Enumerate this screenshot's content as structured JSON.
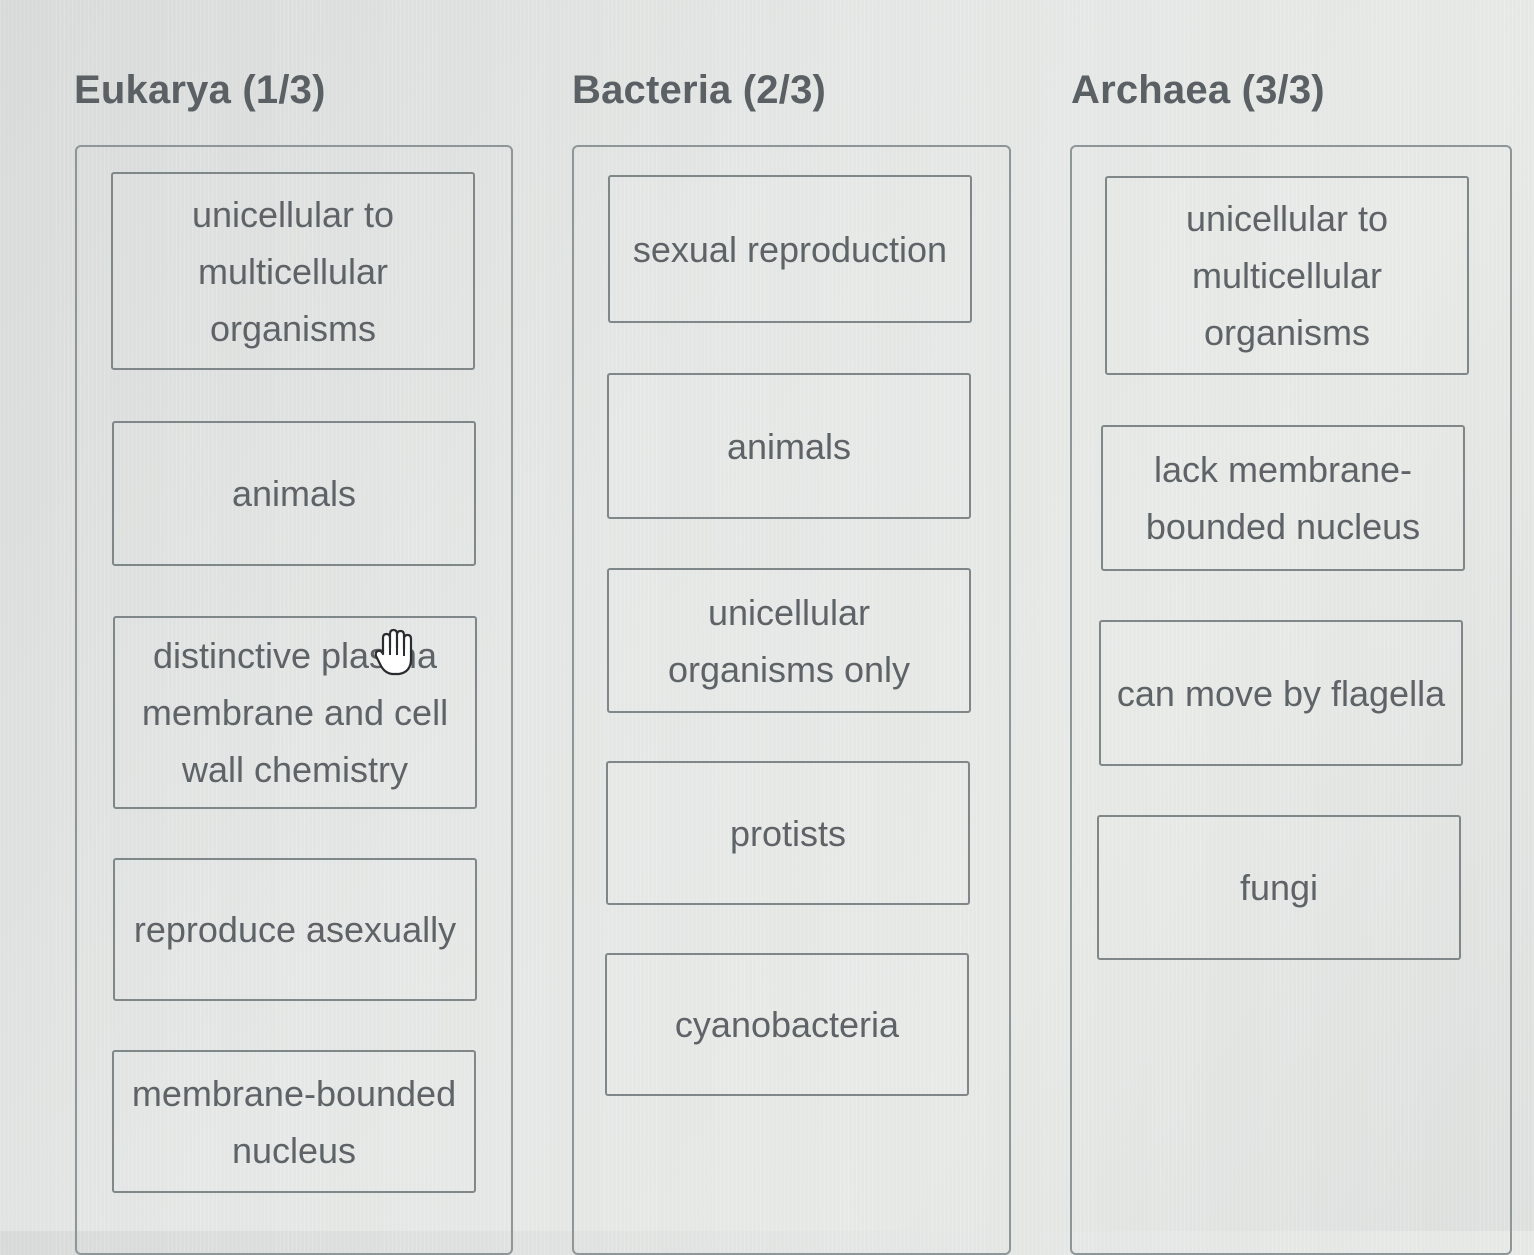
{
  "columns": [
    {
      "heading": "Eukarya (1/3)",
      "cards": [
        "unicellular to multicellular organisms",
        "animals",
        "distinctive plasma membrane and cell wall chemistry",
        "reproduce asexually",
        "membrane-bounded nucleus"
      ]
    },
    {
      "heading": "Bacteria (2/3)",
      "cards": [
        "sexual reproduction",
        "animals",
        "unicellular organisms only",
        "protists",
        "cyanobacteria"
      ]
    },
    {
      "heading": "Archaea (3/3)",
      "cards": [
        "unicellular to multicellular organisms",
        "lack membrane-bounded nucleus",
        "can move by flagella",
        "fungi"
      ]
    }
  ],
  "cursor_icon": "hand-grab-icon"
}
